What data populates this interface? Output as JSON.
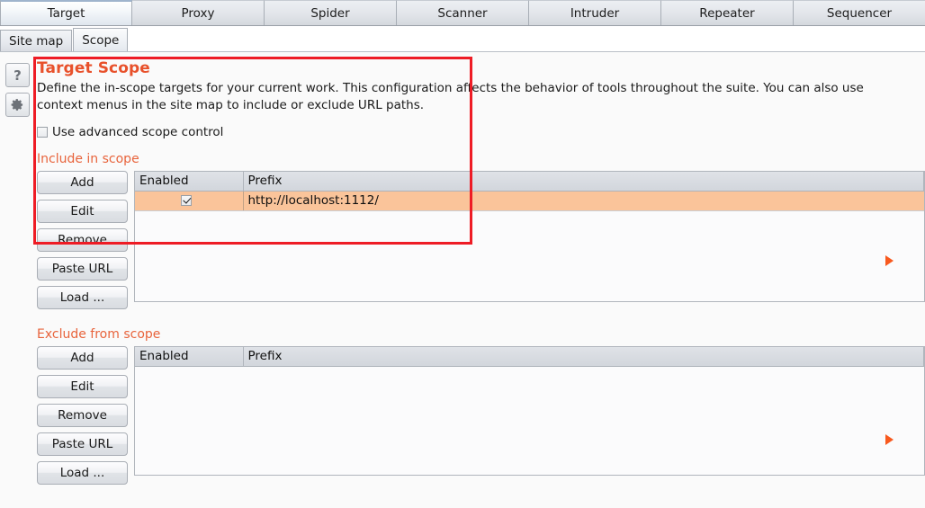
{
  "window": {
    "top_tabs": [
      {
        "label": "Target",
        "selected": true
      },
      {
        "label": "Proxy",
        "selected": false
      },
      {
        "label": "Spider",
        "selected": false
      },
      {
        "label": "Scanner",
        "selected": false
      },
      {
        "label": "Intruder",
        "selected": false
      },
      {
        "label": "Repeater",
        "selected": false
      },
      {
        "label": "Sequencer",
        "selected": false
      }
    ],
    "sub_tabs": [
      {
        "label": "Site map",
        "selected": false
      },
      {
        "label": "Scope",
        "selected": true
      }
    ]
  },
  "side_buttons": [
    {
      "name": "help-button",
      "glyph": "?"
    },
    {
      "name": "settings-gear-button",
      "glyph": "gear"
    }
  ],
  "page": {
    "title": "Target Scope",
    "description_line1": "Define the in-scope targets for your current work. This configuration affects the behavior of tools throughout the suite. You can also use",
    "description_line2": "context menus in the site map to include or exclude URL paths.",
    "advanced_checkbox": {
      "label": "Use advanced scope control",
      "checked": false
    }
  },
  "include_section": {
    "heading": "Include in scope",
    "buttons": [
      {
        "label": "Add",
        "name": "include-add-button"
      },
      {
        "label": "Edit",
        "name": "include-edit-button"
      },
      {
        "label": "Remove",
        "name": "include-remove-button"
      },
      {
        "label": "Paste URL",
        "name": "include-paste-url-button"
      },
      {
        "label": "Load ...",
        "name": "include-load-button"
      }
    ],
    "columns": [
      "Enabled",
      "Prefix"
    ],
    "rows": [
      {
        "enabled": true,
        "prefix": "http://localhost:1112/"
      }
    ]
  },
  "exclude_section": {
    "heading": "Exclude from scope",
    "buttons": [
      {
        "label": "Add",
        "name": "exclude-add-button"
      },
      {
        "label": "Edit",
        "name": "exclude-edit-button"
      },
      {
        "label": "Remove",
        "name": "exclude-remove-button"
      },
      {
        "label": "Paste URL",
        "name": "exclude-paste-url-button"
      },
      {
        "label": "Load ...",
        "name": "exclude-load-button"
      }
    ],
    "columns": [
      "Enabled",
      "Prefix"
    ],
    "rows": []
  },
  "colors": {
    "accent_orange": "#e8512b",
    "section_orange": "#e8643c",
    "annotation_red": "#ee1c25",
    "row_highlight": "#fac49a",
    "marker_orange": "#f8591e"
  }
}
